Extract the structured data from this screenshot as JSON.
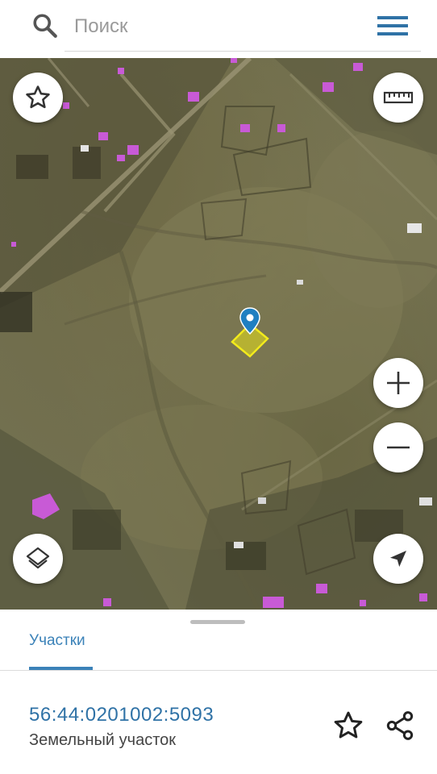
{
  "search": {
    "placeholder": "Поиск",
    "icon": "search-icon"
  },
  "header": {
    "menu_icon": "hamburger-menu-icon"
  },
  "map": {
    "controls": {
      "favorites_icon": "star-icon",
      "ruler_icon": "ruler-icon",
      "zoom_in_icon": "plus-icon",
      "zoom_out_icon": "minus-icon",
      "layers_icon": "layers-icon",
      "locate_icon": "navigation-arrow-icon"
    },
    "marker_color": "#1f7fc1",
    "parcel_highlight_color": "#e8e21a",
    "building_color": "#c85ad6"
  },
  "sheet": {
    "tabs": [
      {
        "label": "Участки",
        "active": true
      }
    ],
    "parcel": {
      "number": "56:44:0201002:5093",
      "type": "Земельный участок"
    },
    "accent_color": "#3b82b8"
  }
}
